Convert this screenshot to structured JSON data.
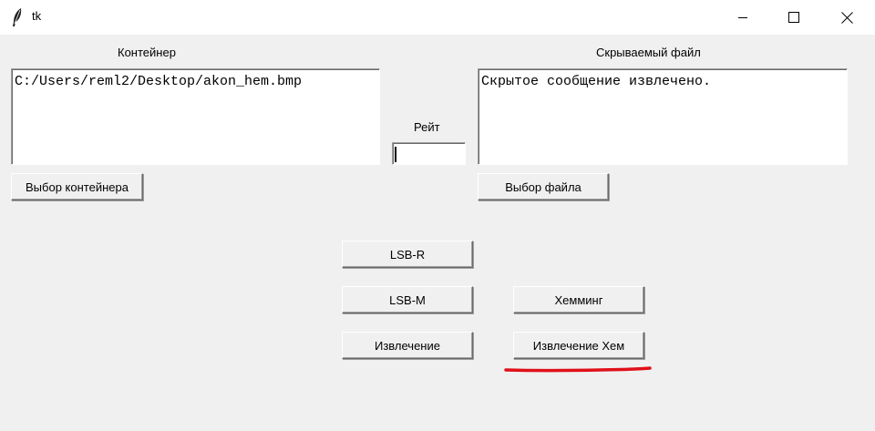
{
  "window": {
    "title": "tk"
  },
  "container": {
    "label": "Контейнер",
    "path_value": "C:/Users/reml2/Desktop/akon_hem.bmp",
    "select_button": "Выбор контейнера"
  },
  "hidden_file": {
    "label": "Скрываемый файл",
    "text_value": "Скрытое сообщение извлечено.",
    "select_button": "Выбор файла"
  },
  "rate": {
    "label": "Рейт",
    "value": ""
  },
  "actions": {
    "lsb_r": "LSB-R",
    "lsb_m": "LSB-M",
    "extract": "Извлечение",
    "hamming": "Хемминг",
    "extract_hamming": "Извлечение Хем"
  },
  "annotation": {
    "underline_color": "#e0101a"
  }
}
